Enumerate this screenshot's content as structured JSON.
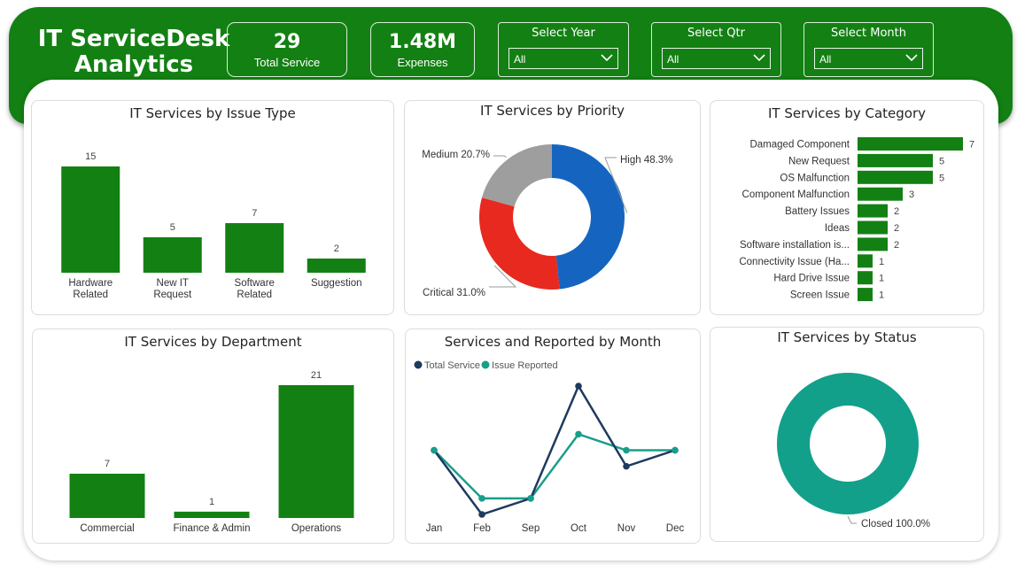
{
  "header": {
    "title_line1": "IT ServiceDesk",
    "title_line2": "Analytics",
    "kpis": [
      {
        "value": "29",
        "label": "Total Service"
      },
      {
        "value": "1.48M",
        "label": "Expenses"
      }
    ],
    "slicers": [
      {
        "label": "Select Year",
        "value": "All"
      },
      {
        "label": "Select Qtr",
        "value": "All"
      },
      {
        "label": "Select Month",
        "value": "All"
      }
    ]
  },
  "colors": {
    "green": "#138013",
    "high": "#1565C0",
    "critical": "#E8291F",
    "medium": "#9E9E9E",
    "total_service": "#1E3A5F",
    "issue_reported": "#1A9E8A",
    "closed": "#12A08A"
  },
  "visuals": {
    "issue_type": {
      "title": "IT Services by Issue Type"
    },
    "priority": {
      "title": "IT Services by Priority"
    },
    "category": {
      "title": "IT Services by Category"
    },
    "department": {
      "title": "IT Services by Department"
    },
    "monthly": {
      "title": "Services and Reported by Month"
    },
    "status": {
      "title": "IT Services by Status"
    }
  },
  "chart_data": [
    {
      "type": "bar",
      "categories": [
        "Hardware Related",
        "New IT Request",
        "Software Related",
        "Suggestion"
      ],
      "category_lines": [
        [
          "Hardware",
          "Related"
        ],
        [
          "New IT",
          "Request"
        ],
        [
          "Software",
          "Related"
        ],
        [
          "Suggestion"
        ]
      ],
      "values": [
        15,
        5,
        7,
        2
      ],
      "title": "IT Services by Issue Type",
      "data_labels": true
    },
    {
      "type": "pie",
      "donut": true,
      "title": "IT Services by Priority",
      "slices": [
        {
          "name": "High",
          "value": 48.3,
          "label": "High 48.3%",
          "color": "#1565C0"
        },
        {
          "name": "Critical",
          "value": 31.0,
          "label": "Critical 31.0%",
          "color": "#E8291F"
        },
        {
          "name": "Medium",
          "value": 20.7,
          "label": "Medium 20.7%",
          "color": "#9E9E9E"
        }
      ]
    },
    {
      "type": "bar",
      "orientation": "horizontal",
      "title": "IT Services by Category",
      "categories": [
        "Damaged Component",
        "New Request",
        "OS Malfunction",
        "Component Malfunction",
        "Battery Issues",
        "Ideas",
        "Software installation is...",
        "Connectivity Issue (Ha...",
        "Hard Drive Issue",
        "Screen Issue"
      ],
      "values": [
        7,
        5,
        5,
        3,
        2,
        2,
        2,
        1,
        1,
        1
      ],
      "data_labels": true
    },
    {
      "type": "bar",
      "title": "IT Services by Department",
      "categories": [
        "Commercial",
        "Finance & Admin",
        "Operations"
      ],
      "values": [
        7,
        1,
        21
      ],
      "data_labels": true
    },
    {
      "type": "line",
      "title": "Services and Reported by Month",
      "x": [
        "Jan",
        "Feb",
        "Sep",
        "Oct",
        "Nov",
        "Dec"
      ],
      "series": [
        {
          "name": "Total Service",
          "values": [
            5,
            1,
            2,
            9,
            4,
            5
          ],
          "color": "#1E3A5F"
        },
        {
          "name": "Issue Reported",
          "values": [
            5,
            2,
            2,
            6,
            5,
            5
          ],
          "color": "#1A9E8A"
        }
      ],
      "legend": "top-left",
      "ylim": [
        1,
        9
      ]
    },
    {
      "type": "pie",
      "donut": true,
      "title": "IT Services by Status",
      "slices": [
        {
          "name": "Closed",
          "value": 100.0,
          "label": "Closed 100.0%",
          "color": "#12A08A"
        }
      ]
    }
  ]
}
